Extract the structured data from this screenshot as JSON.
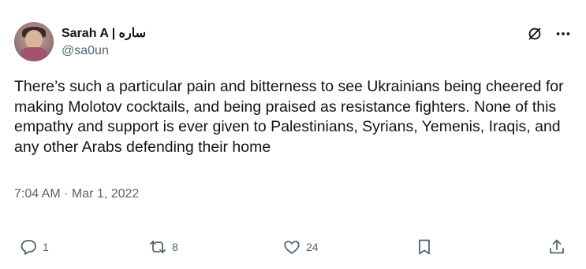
{
  "author": {
    "display_name": "Sarah A | ساره",
    "handle": "@sa0un",
    "avatar_icon": "avatar-photo"
  },
  "header_icons": [
    "grok-icon",
    "more-options-icon"
  ],
  "tweet": {
    "text": "There’s such a particular pain and bitterness to see Ukrainians being cheered for making Molotov cocktails, and being praised as resistance fighters. None of this empathy and support is ever given to Palestinians, Syrians, Yemenis, Iraqis, and any other Arabs defending their home",
    "timestamp": "7:04 AM · Mar 1, 2022"
  },
  "actions": {
    "reply_count": "1",
    "retweet_count": "8",
    "like_count": "24",
    "icons": [
      "reply-icon",
      "retweet-icon",
      "like-icon",
      "bookmark-icon",
      "share-icon"
    ]
  },
  "colors": {
    "text_primary": "#0f1419",
    "text_secondary": "#536471",
    "background": "#ffffff"
  }
}
